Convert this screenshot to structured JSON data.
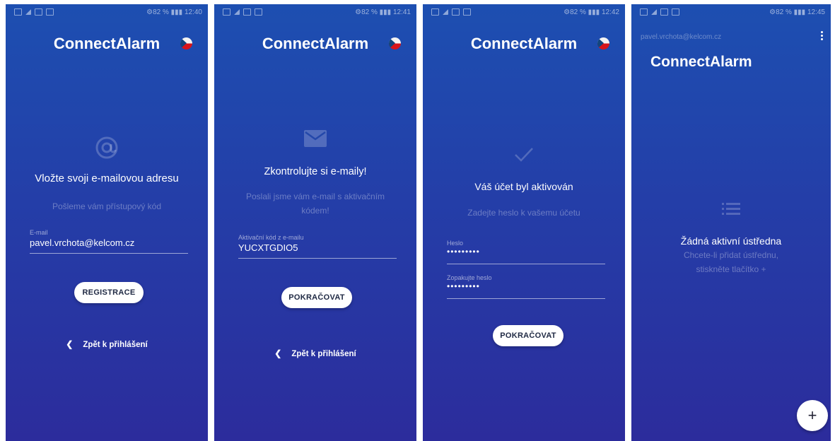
{
  "app_title": "ConnectAlarm",
  "screens": [
    {
      "status_right": "⚙82 % ▮▮▮ 12:40",
      "heading": "Vložte svoji e-mailovou adresu",
      "subtext": "Pošleme vám přístupový kód",
      "field_label": "E-mail",
      "field_value": "pavel.vrchota@kelcom.cz",
      "button_label": "REGISTRACE",
      "back_label": "Zpět k přihlášení",
      "icon": "at-icon"
    },
    {
      "status_right": "⚙82 % ▮▮▮ 12:41",
      "heading": "Zkontrolujte si e-maily!",
      "subtext": "Poslali jsme vám e-mail s aktivačním kódem!",
      "field_label": "Aktivační kód z e-mailu",
      "field_value": "YUCXTGDIO5",
      "button_label": "POKRAČOVAT",
      "back_label": "Zpět k přihlášení",
      "icon": "envelope-icon"
    },
    {
      "status_right": "⚙82 % ▮▮▮ 12:42",
      "heading": "Váš účet byl aktivován",
      "subtext": "Zadejte heslo k vašemu účetu",
      "password_label": "Heslo",
      "password_value": "•••••••••",
      "repeat_label": "Zopakujte heslo",
      "repeat_value": "•••••••••",
      "button_label": "POKRAČOVAT",
      "icon": "checkmark-icon"
    },
    {
      "status_right": "⚙82 % ▮▮▮ 12:45",
      "account_email": "pavel.vrchota@kelcom.cz",
      "heading": "Žádná aktivní ústředna",
      "subtext": "Chcete-li přidat ústřednu, stiskněte tlačítko +",
      "fab_label": "+",
      "icon": "list-icon"
    }
  ],
  "colors": {
    "gradient_top": "#1d4fb1",
    "gradient_bottom": "#2c2c9c",
    "button_bg": "#ffffff",
    "button_text": "#202a44"
  }
}
